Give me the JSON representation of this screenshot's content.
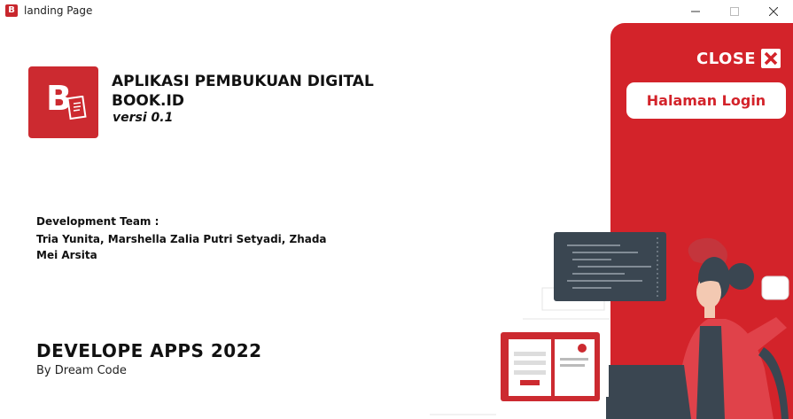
{
  "window": {
    "title": "landing Page",
    "icon_letter": "B"
  },
  "app": {
    "name": "APLIKASI PEMBUKUAN DIGITAL BOOK.ID",
    "version": "versi 0.1",
    "logo_letter": "B"
  },
  "team": {
    "label": "Development Team :",
    "members": "Tria Yunita, Marshella Zalia Putri Setyadi, Zhada Mei Arsita"
  },
  "footer": {
    "headline": "DEVELOPE APPS 2022",
    "byline": "By Dream Code"
  },
  "panel": {
    "close_label": "CLOSE",
    "login_label": "Halaman Login"
  },
  "colors": {
    "brand_red": "#d3232a",
    "logo_red": "#cc2a30",
    "text": "#111111"
  }
}
